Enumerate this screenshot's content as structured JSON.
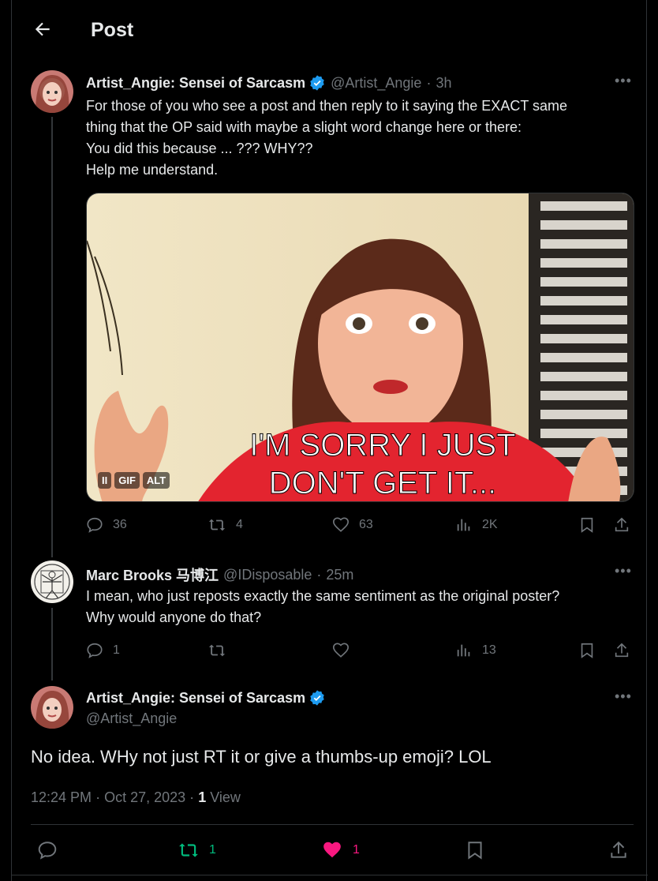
{
  "header": {
    "title": "Post"
  },
  "post1": {
    "display_name": "Artist_Angie: Sensei of Sarcasm",
    "handle": "@Artist_Angie",
    "separator": "·",
    "time": "3h",
    "text_lines": [
      "For those of you who see a post and then reply to it saying the EXACT same",
      "thing that the OP said with maybe a slight word change here or there:",
      "You did this because ... ??? WHY??",
      "Help me understand."
    ],
    "media": {
      "caption_line1": "I'M SORRY I JUST",
      "caption_line2": "DON'T GET IT...",
      "badge_pause": "II",
      "badge_gif": "GIF",
      "badge_alt": "ALT"
    },
    "stats": {
      "replies": "36",
      "reposts": "4",
      "likes": "63",
      "views": "2K"
    }
  },
  "post2": {
    "display_name": "Marc Brooks 马博江",
    "handle": "@IDisposable",
    "separator": "·",
    "time": "25m",
    "text_lines": [
      "I mean, who just reposts exactly the same sentiment as the original poster?",
      "Why would anyone do that?"
    ],
    "stats": {
      "replies": "1",
      "reposts": "",
      "likes": "",
      "views": "13"
    }
  },
  "main_post": {
    "display_name": "Artist_Angie: Sensei of Sarcasm",
    "handle": "@Artist_Angie",
    "text": "No idea. WHy not just RT it or give a thumbs-up emoji? LOL",
    "time": "12:24 PM",
    "date": "Oct 27, 2023",
    "separator": "·",
    "view_count": "1",
    "view_label": "View",
    "stats": {
      "reposts": "1",
      "likes": "1"
    }
  },
  "colors": {
    "accent_blue": "#1d9bf0",
    "repost_green": "#00ba7c",
    "like_pink": "#f91880",
    "muted": "#71767b"
  }
}
